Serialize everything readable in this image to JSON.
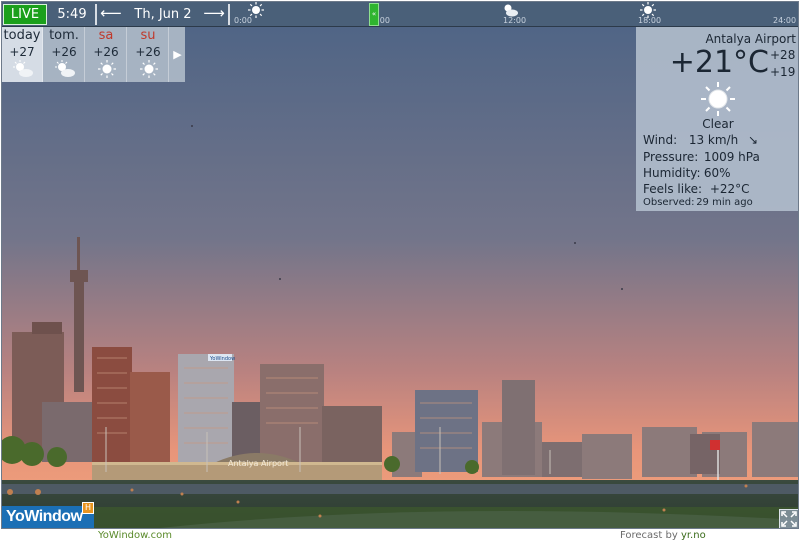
{
  "topbar": {
    "live_label": "LIVE",
    "time": "5:49",
    "prev_arrow": "⟵",
    "date": "Th, Jun 2",
    "next_arrow": "⟶",
    "timeline_ticks": [
      "0:00",
      "6:00",
      "12:00",
      "18:00",
      "24:00"
    ],
    "handle_label": "«"
  },
  "forecast": {
    "days": [
      {
        "name": "today",
        "temp": "+27",
        "icon": "partly-cloudy-icon",
        "weekend": false
      },
      {
        "name": "tom.",
        "temp": "+26",
        "icon": "partly-cloudy-icon",
        "weekend": false
      },
      {
        "name": "sa",
        "temp": "+26",
        "icon": "sun-icon",
        "weekend": true
      },
      {
        "name": "su",
        "temp": "+26",
        "icon": "sun-icon",
        "weekend": true
      }
    ],
    "more_arrow": "▶"
  },
  "current": {
    "station": "Antalya Airport",
    "temperature": "+21°C",
    "high": "+28",
    "low": "+19",
    "icon": "sun-icon",
    "description": "Clear",
    "wind_label": "Wind:",
    "wind_value": "13 km/h",
    "wind_arrow": "↘",
    "pressure_label": "Pressure:",
    "pressure_value": "1009 hPa",
    "humidity_label": "Humidity:",
    "humidity_value": "60%",
    "feels_label": "Feels like:",
    "feels_value": "+22°C",
    "observed_label": "Observed:",
    "observed_value": "29 min ago"
  },
  "scene": {
    "airport_sign": "Antalya Airport",
    "billboard": "YoWindow"
  },
  "branding": {
    "logo": "YoWindow",
    "badge": "H"
  },
  "footer": {
    "left_link": "YoWindow.com",
    "right_prefix": "Forecast by ",
    "right_link": "yr.no"
  },
  "colors": {
    "sky_top": "#4e6585",
    "sky_bottom": "#ee9a72",
    "live_green": "#1ba01b",
    "logo_blue": "#1b6fb5"
  }
}
